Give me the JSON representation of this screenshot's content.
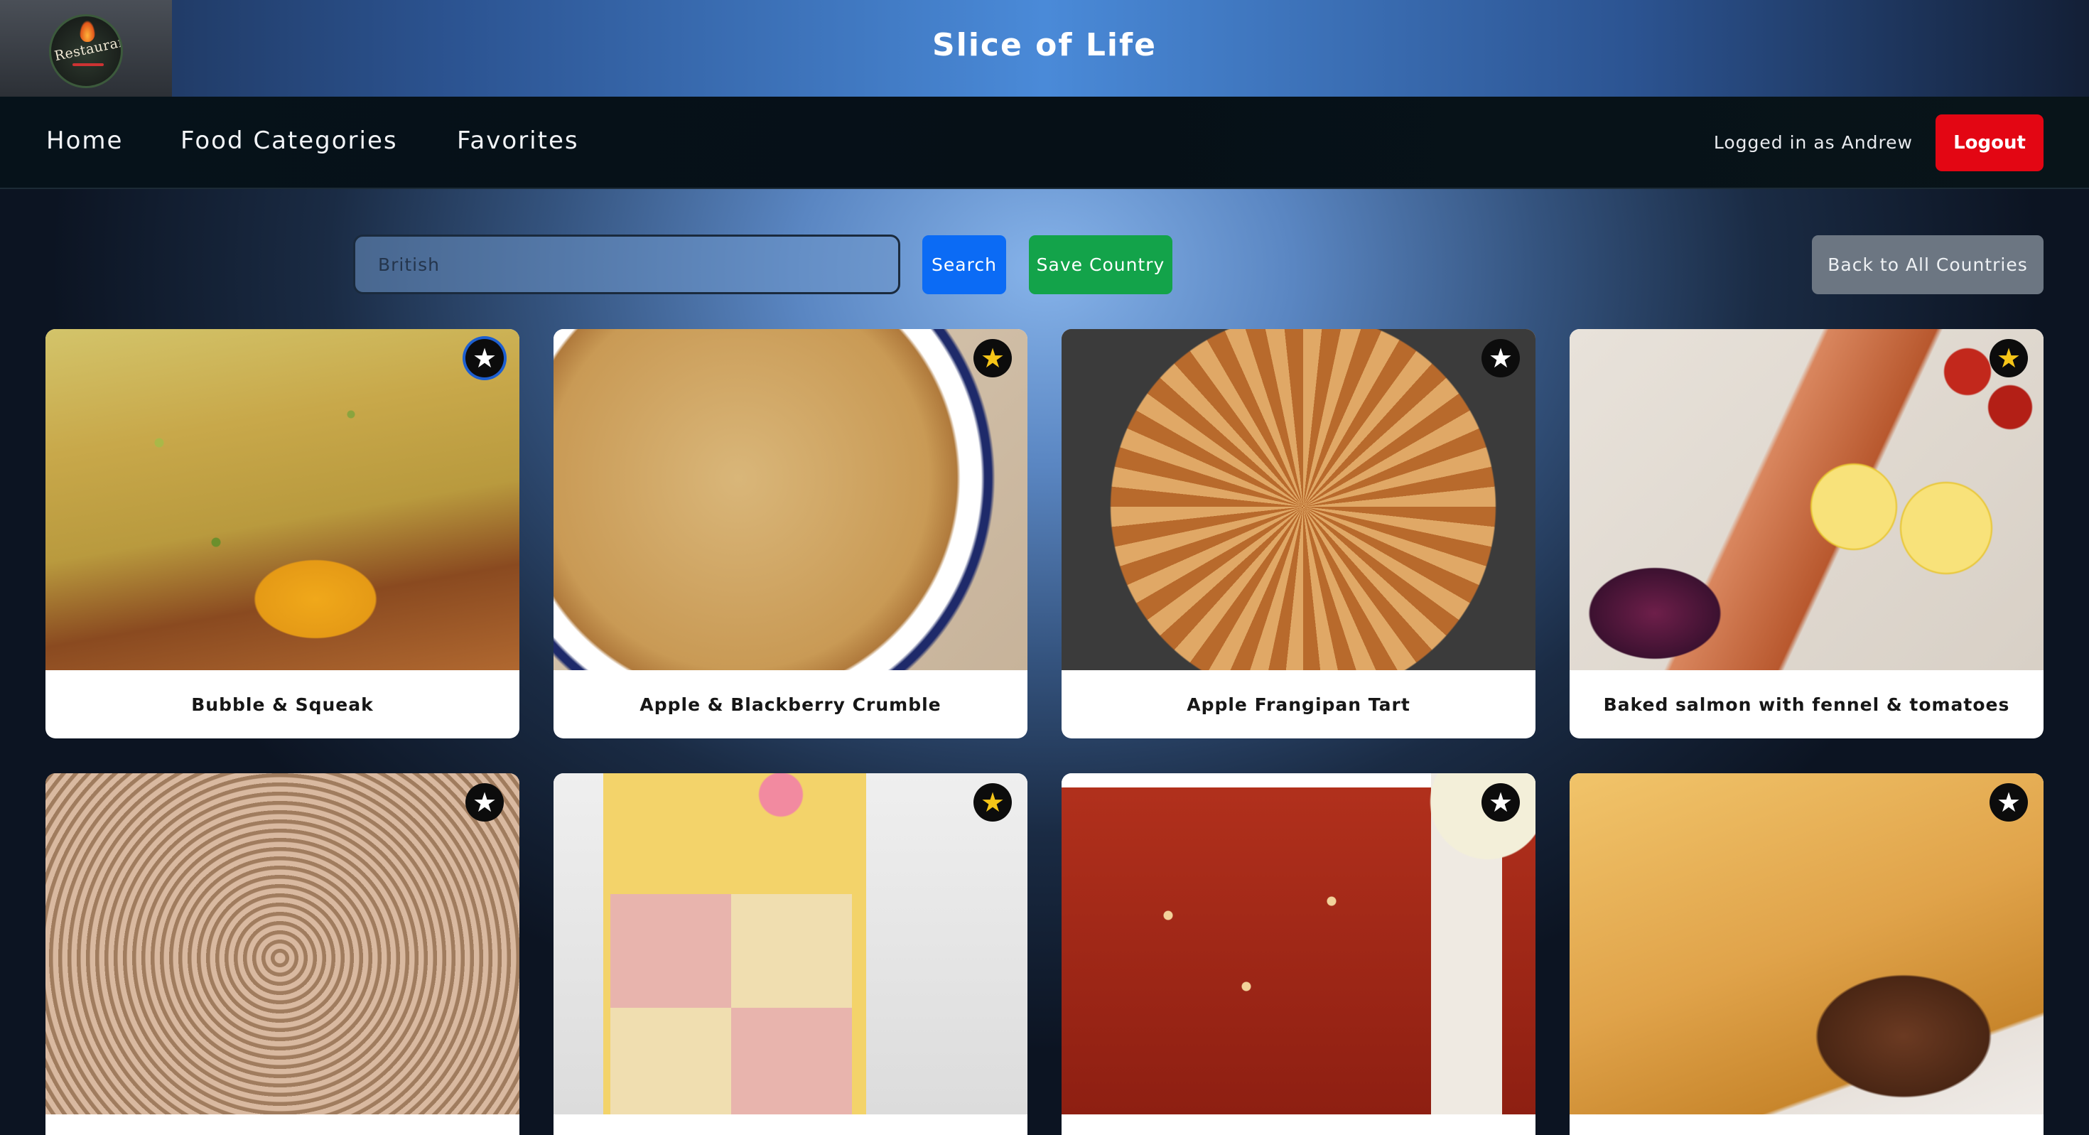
{
  "header": {
    "site_title": "Slice of Life",
    "logo_text": "Restaurant"
  },
  "nav": {
    "home": "Home",
    "food_categories": "Food Categories",
    "favorites": "Favorites",
    "user_status": "Logged in as Andrew",
    "logout": "Logout"
  },
  "controls": {
    "search_placeholder": "British",
    "search_button": "Search",
    "save_button": "Save Country",
    "back_button": "Back to All Countries"
  },
  "colors": {
    "search_button": "#0b6bf5",
    "save_button": "#13a34a",
    "back_button": "#6c7682",
    "logout_button": "#e30613",
    "favorite_star": "#f5c518"
  },
  "meals": [
    {
      "title": "Bubble & Squeak",
      "favorite": false,
      "image": "bubble-and-squeak"
    },
    {
      "title": "Apple & Blackberry Crumble",
      "favorite": true,
      "image": "crumble"
    },
    {
      "title": "Apple Frangipan Tart",
      "favorite": false,
      "image": "frangipan-tart"
    },
    {
      "title": "Baked salmon with fennel & tomatoes",
      "favorite": true,
      "image": "baked-salmon"
    },
    {
      "title": "",
      "favorite": false,
      "image": "almond-tart"
    },
    {
      "title": "",
      "favorite": true,
      "image": "battenberg-cake"
    },
    {
      "title": "",
      "favorite": false,
      "image": "baked-beans"
    },
    {
      "title": "",
      "favorite": false,
      "image": "beef-pie"
    }
  ]
}
